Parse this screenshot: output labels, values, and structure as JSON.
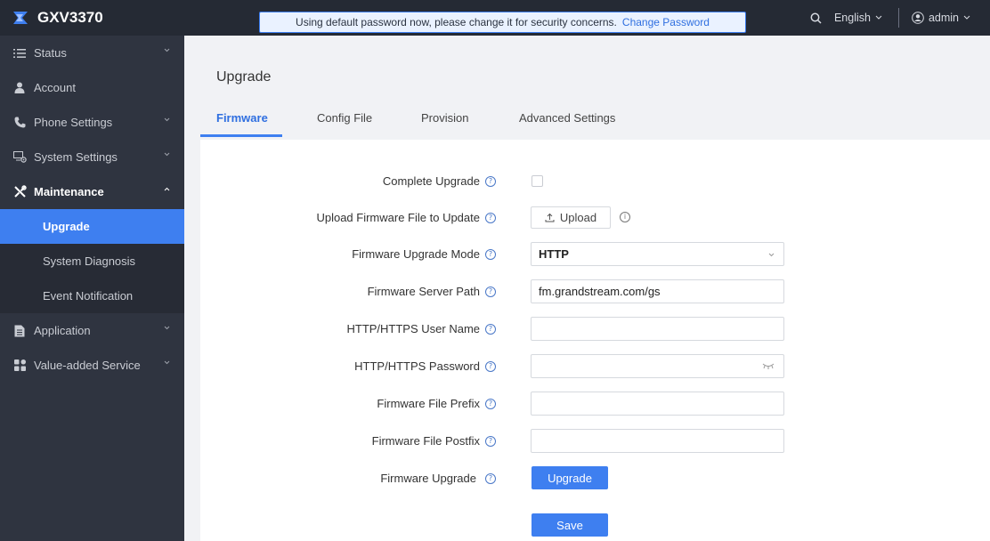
{
  "app": {
    "title": "GXV3370"
  },
  "topbar": {
    "notice_text": "Using default password now, please change it for security concerns.",
    "notice_link": "Change Password",
    "language": "English",
    "user": "admin"
  },
  "sidebar": {
    "items": [
      {
        "label": "Status"
      },
      {
        "label": "Account"
      },
      {
        "label": "Phone Settings"
      },
      {
        "label": "System Settings"
      },
      {
        "label": "Maintenance"
      },
      {
        "label": "Application"
      },
      {
        "label": "Value-added Service"
      }
    ],
    "maintenance_sub": [
      {
        "label": "Upgrade"
      },
      {
        "label": "System Diagnosis"
      },
      {
        "label": "Event Notification"
      }
    ]
  },
  "page": {
    "title": "Upgrade"
  },
  "tabs": [
    {
      "label": "Firmware"
    },
    {
      "label": "Config File"
    },
    {
      "label": "Provision"
    },
    {
      "label": "Advanced Settings"
    }
  ],
  "form": {
    "complete_upgrade_label": "Complete Upgrade",
    "upload_label": "Upload Firmware File to Update",
    "upload_button": "Upload",
    "mode_label": "Firmware Upgrade Mode",
    "mode_value": "HTTP",
    "server_path_label": "Firmware Server Path",
    "server_path_value": "fm.grandstream.com/gs",
    "username_label": "HTTP/HTTPS User Name",
    "password_label": "HTTP/HTTPS Password",
    "prefix_label": "Firmware File Prefix",
    "postfix_label": "Firmware File Postfix",
    "fw_upgrade_label": "Firmware Upgrade",
    "upgrade_button": "Upgrade",
    "save_button": "Save"
  },
  "colors": {
    "accent": "#3e7ff0",
    "sidebar_bg": "#2f3440",
    "topbar_bg": "#252a34"
  }
}
